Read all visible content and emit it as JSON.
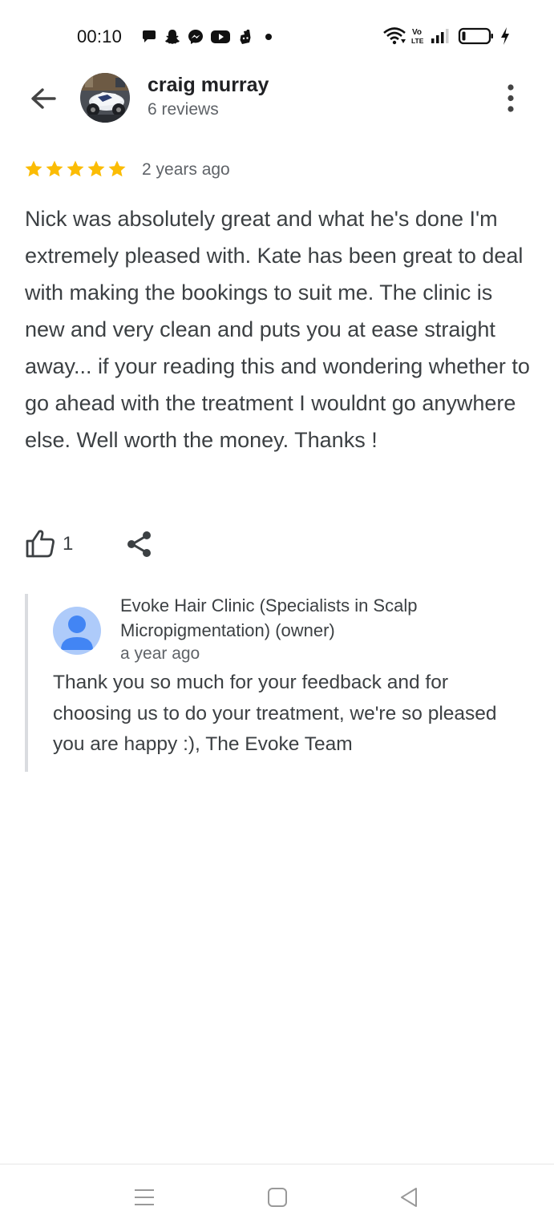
{
  "status_bar": {
    "time": "00:10",
    "left_icons": [
      "chat-icon",
      "snapchat-icon",
      "messenger-icon",
      "youtube-icon",
      "deliveroo-icon",
      "dot-icon"
    ],
    "right_icons": [
      "wifi-icon",
      "volte-icon",
      "signal-icon",
      "battery-icon",
      "charging-icon"
    ],
    "volte_label_top": "Vo",
    "volte_label_bottom": "LTE"
  },
  "header": {
    "reviewer_name": "craig murray",
    "review_count": "6 reviews"
  },
  "review": {
    "rating": 5,
    "star_color": "#fbbc04",
    "time_ago": "2 years ago",
    "text": "Nick was absolutely great and what he's done I'm extremely pleased with. Kate has been great to deal with making the bookings to suit me. The clinic is new and very clean and puts you at ease straight away... if your reading this and wondering whether to go ahead with the treatment I wouldnt go anywhere else. Well worth the money. Thanks !",
    "like_count": "1"
  },
  "owner_reply": {
    "owner_name": "Evoke Hair Clinic (Specialists in Scalp Micropigmentation) (owner)",
    "time_ago": "a year ago",
    "text": "Thank you so much for your feedback and for choosing us to do your treatment, we're so pleased you are happy :), The Evoke Team",
    "avatar_color": "#4285f4"
  },
  "nav_bar": {
    "buttons": [
      "menu-icon",
      "home-icon",
      "back-triangle-icon"
    ]
  }
}
